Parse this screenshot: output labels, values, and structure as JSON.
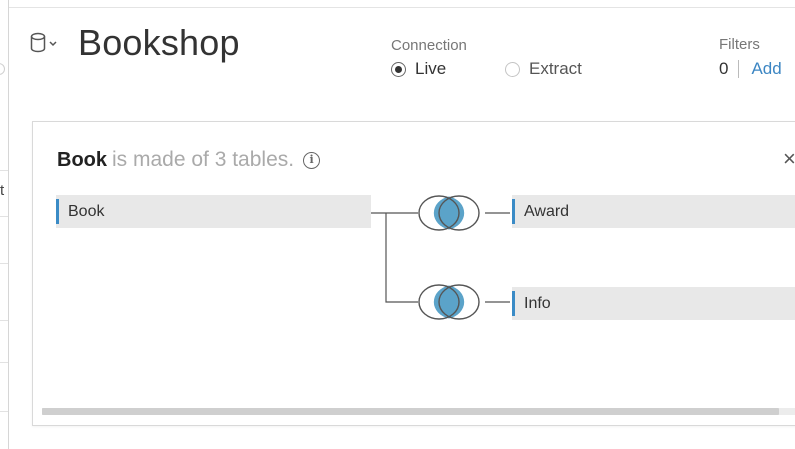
{
  "datasource": {
    "title": "Bookshop",
    "icon": "database-icon"
  },
  "connection": {
    "label": "Connection",
    "options": [
      {
        "label": "Live",
        "selected": true
      },
      {
        "label": "Extract",
        "selected": false
      }
    ]
  },
  "filters": {
    "label": "Filters",
    "count": "0",
    "add_label": "Add"
  },
  "join_panel": {
    "table_name": "Book",
    "description": "is made of 3 tables.",
    "tables": {
      "left": "Book",
      "right1": "Award",
      "right2": "Info"
    },
    "join_type": "inner",
    "colors": {
      "accent": "#3a8bc6",
      "join_fill": "#5ba3c9"
    }
  }
}
